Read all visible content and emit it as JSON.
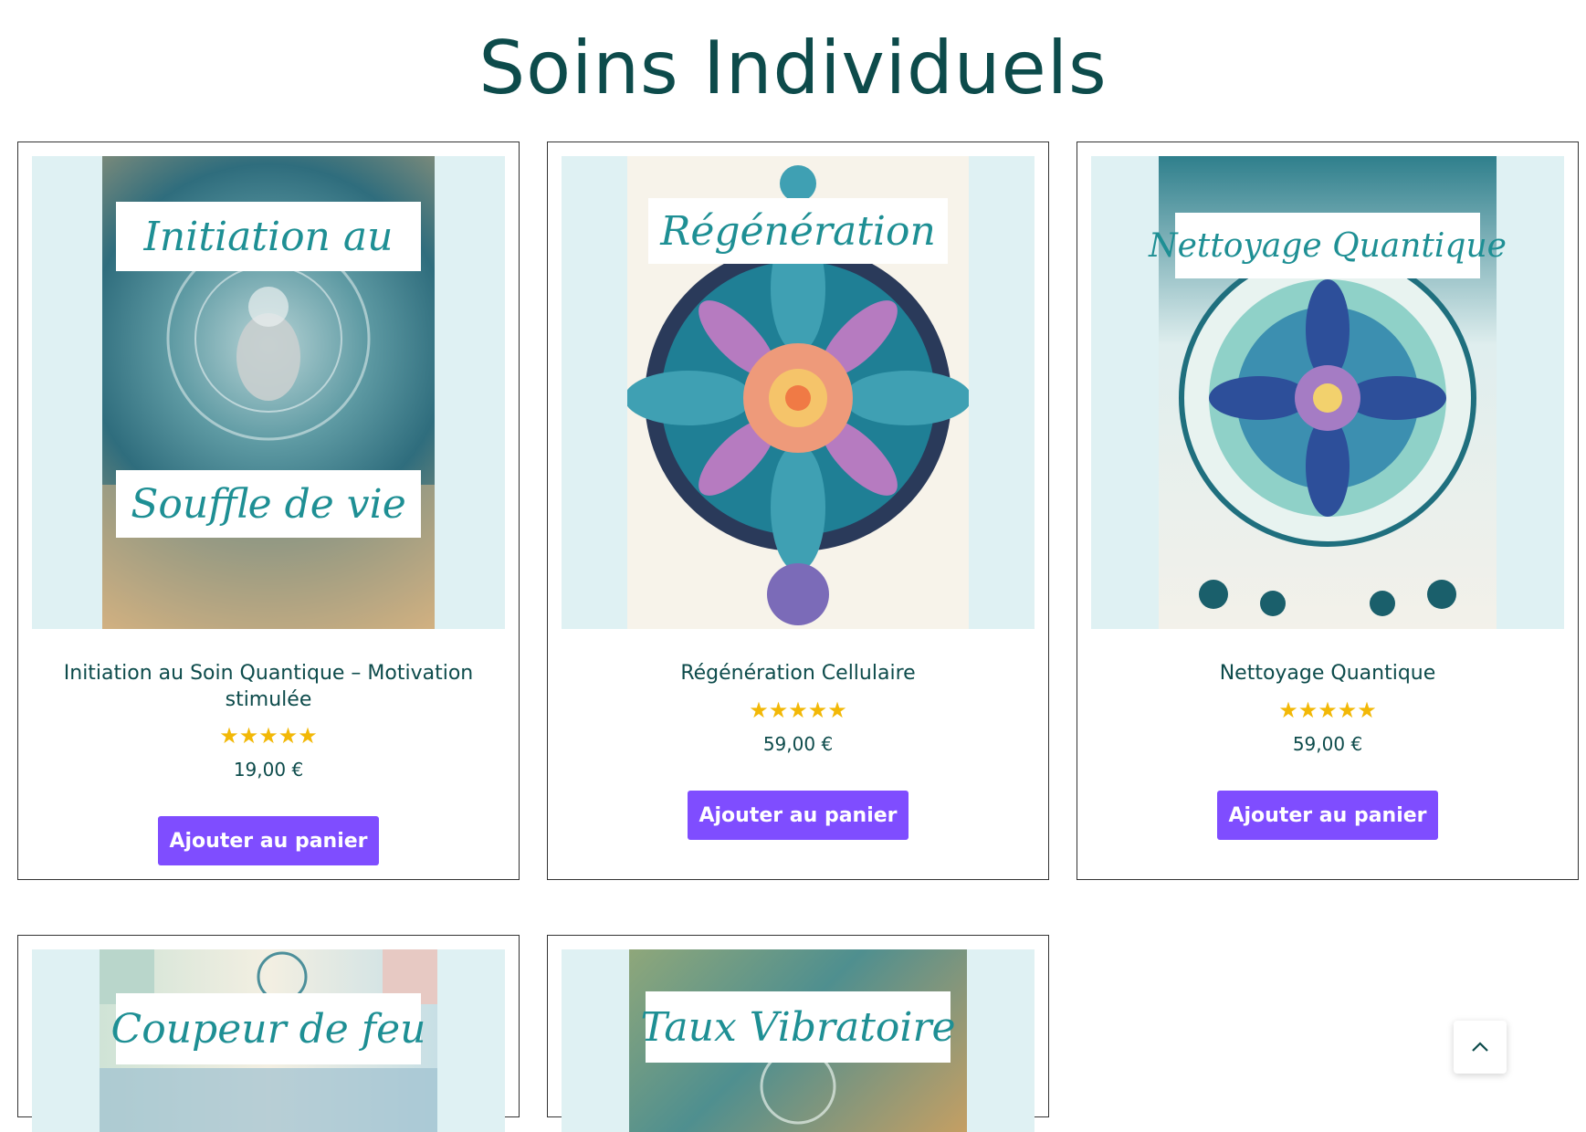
{
  "page_title": "Soins Individuels",
  "products": [
    {
      "poster_top_text": "Initiation au",
      "poster_bottom_text": "Souffle de vie",
      "title": "Initiation au Soin Quantique – Motivation stimulée",
      "stars": "★★★★★",
      "price": "19,00 €",
      "button": "Ajouter au panier"
    },
    {
      "poster_top_text": "Régénération",
      "title": "Régénération Cellulaire",
      "stars": "★★★★★",
      "price": "59,00 €",
      "button": "Ajouter au panier"
    },
    {
      "poster_top_text": "Nettoyage Quantique",
      "title": "Nettoyage Quantique",
      "stars": "★★★★★",
      "price": "59,00 €",
      "button": "Ajouter au panier"
    },
    {
      "poster_top_text": "Coupeur de feu"
    },
    {
      "poster_top_text": "Taux Vibratoire"
    }
  ],
  "colors": {
    "accent": "#7f4dff",
    "title": "#0d4b4b",
    "star": "#f2b807",
    "image_bg": "#dff1f3",
    "poster_text": "#1e8f94"
  },
  "icons": {
    "back_to_top": "chevron-up-icon",
    "rating": "star-icon"
  }
}
